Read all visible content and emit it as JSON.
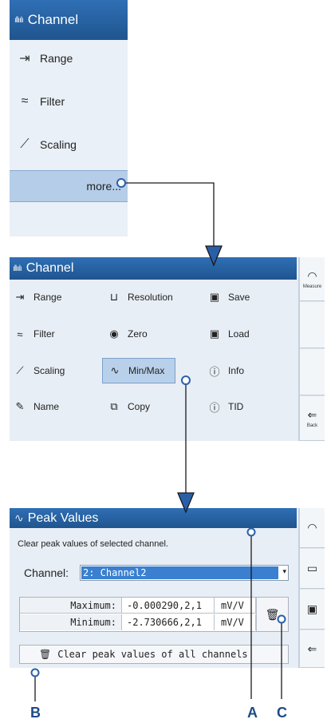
{
  "panel1": {
    "title": "Channel",
    "items": [
      {
        "label": "Range",
        "icon": "range-icon"
      },
      {
        "label": "Filter",
        "icon": "filter-icon"
      },
      {
        "label": "Scaling",
        "icon": "scaling-icon"
      }
    ],
    "more_label": "more..."
  },
  "panel2": {
    "title": "Channel",
    "items": [
      {
        "label": "Range"
      },
      {
        "label": "Resolution"
      },
      {
        "label": "Save"
      },
      {
        "label": "Filter"
      },
      {
        "label": "Zero"
      },
      {
        "label": "Load"
      },
      {
        "label": "Scaling"
      },
      {
        "label": "Min/Max"
      },
      {
        "label": "Info"
      },
      {
        "label": "Name"
      },
      {
        "label": "Copy"
      },
      {
        "label": "TID"
      }
    ],
    "selected": "Min/Max",
    "sidebar": {
      "measure_label": "Measure",
      "back_label": "Back"
    }
  },
  "panel3": {
    "title": "Peak Values",
    "description": "Clear peak values of selected channel.",
    "channel_label": "Channel:",
    "channel_value": "2: Channel2",
    "table": {
      "rows": [
        {
          "label": "Maximum:",
          "value": "-0.000290,2,1",
          "unit": "mV/V"
        },
        {
          "label": "Minimum:",
          "value": "-2.730666,2,1",
          "unit": "mV/V"
        }
      ]
    },
    "clear_all_label": "Clear peak values of all channels"
  },
  "callouts": {
    "a": "A",
    "b": "B",
    "c": "C"
  },
  "colors": {
    "header": "#2866ab",
    "selected": "#b9d0ea",
    "accent": "#1d4b86",
    "select_highlight": "#3a7fd0"
  }
}
